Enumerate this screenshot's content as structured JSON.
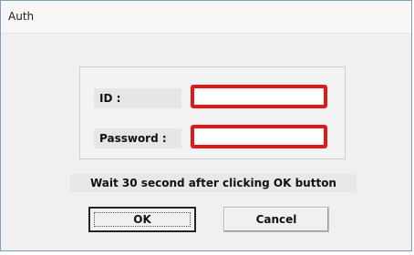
{
  "window": {
    "title": "Auth"
  },
  "form": {
    "id_label": "ID :",
    "id_value": "",
    "password_label": "Password :",
    "password_value": ""
  },
  "notice": "Wait 30 second after clicking OK button",
  "buttons": {
    "ok": "OK",
    "cancel": "Cancel"
  },
  "colors": {
    "field_border": "#e01818",
    "window_bg": "#f0f0f0"
  }
}
